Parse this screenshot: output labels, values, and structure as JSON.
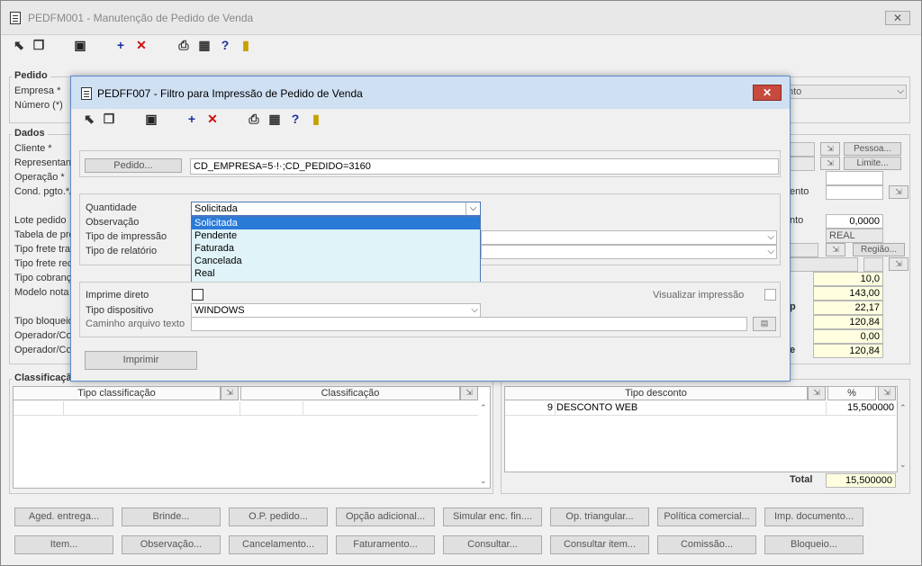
{
  "main": {
    "title": "PEDFM001 - Manutenção de Pedido de Venda",
    "close": "✕",
    "groups": {
      "pedido": "Pedido",
      "dados": "Dados",
      "classificacao": "Classificação"
    },
    "labels": {
      "empresa": "Empresa *",
      "numero": "Número (*)",
      "cliente": "Cliente *",
      "representante": "Representan",
      "operacao": "Operação *",
      "cond_pgto": "Cond. pgto.*/",
      "lote_pedido": "Lote pedido",
      "tabela": "Tabela de pre",
      "tipo_frete_tra": "Tipo frete tra",
      "tipo_frete_rec": "Tipo frete rec",
      "tipo_cobranca": "Tipo cobranç",
      "modelo_nota": "Modelo nota f",
      "tipo_bloqueio": "Tipo bloqueio",
      "operador1": "Operador/Co",
      "operador2": "Operador/Co",
      "ento1": "ento",
      "ento2": "nto",
      "ento3": "nto",
      "p": "p",
      "e": "e",
      "total": "Total"
    },
    "right_fields": {
      "pessoa": "Pessoa...",
      "limite": "Limite...",
      "value_0": "0,0000",
      "real": "REAL",
      "regiao": "Região...",
      "v1": "10,0",
      "v2": "143,00",
      "v3": "22,17",
      "v4": "120,84",
      "v5": "0,00",
      "v6": "120,84",
      "empresa_tail": "nto"
    },
    "class_table": {
      "col1": "Tipo classificação",
      "col2": "Classificação"
    },
    "desc_table": {
      "col1": "Tipo desconto",
      "col2": "%",
      "rows": [
        {
          "code": "9",
          "name": "DESCONTO WEB",
          "pct": "15,500000"
        }
      ],
      "total_value": "15,500000"
    },
    "buttons_row1": [
      "Aged. entrega...",
      "Brinde...",
      "O.P. pedido...",
      "Opção adicional...",
      "Simular enc. fin....",
      "Op. triangular...",
      "Política comercial...",
      "Imp. documento..."
    ],
    "buttons_row2": [
      "Item...",
      "Observação...",
      "Cancelamento...",
      "Faturamento...",
      "Consultar...",
      "Consultar item...",
      "Comissão...",
      "Bloqueio..."
    ]
  },
  "dialog": {
    "title": "PEDFF007 - Filtro para Impressão de Pedido de Venda",
    "pedido_button": "Pedido...",
    "pedido_value": "CD_EMPRESA=5·!·;CD_PEDIDO=3160",
    "labels": {
      "quantidade": "Quantidade",
      "observacao": "Observação",
      "tipo_impressao": "Tipo de impressão",
      "tipo_relatorio": "Tipo de relatório",
      "imprime_direto": "Imprime direto",
      "tipo_dispositivo": "Tipo dispositivo",
      "caminho": "Caminho arquivo texto",
      "visualizar": "Visualizar impressão"
    },
    "quantidade_value": "Solicitada",
    "quantidade_options": [
      "Solicitada",
      "Pendente",
      "Faturada",
      "Cancelada",
      "Real"
    ],
    "tipo_dispositivo_value": "WINDOWS",
    "imprimir": "Imprimir"
  },
  "icons": {
    "toolbar": [
      "select-icon",
      "copy-icon",
      "save-icon",
      "add-icon",
      "delete-icon",
      "print-icon",
      "grid-icon",
      "help-icon",
      "exit-icon"
    ]
  },
  "colors": {
    "dialog_title_bg": "#cfe0f3",
    "close_red": "#c74a3c",
    "dropdown_sel": "#2a7ad8",
    "yellow_field": "#ffffe0"
  }
}
